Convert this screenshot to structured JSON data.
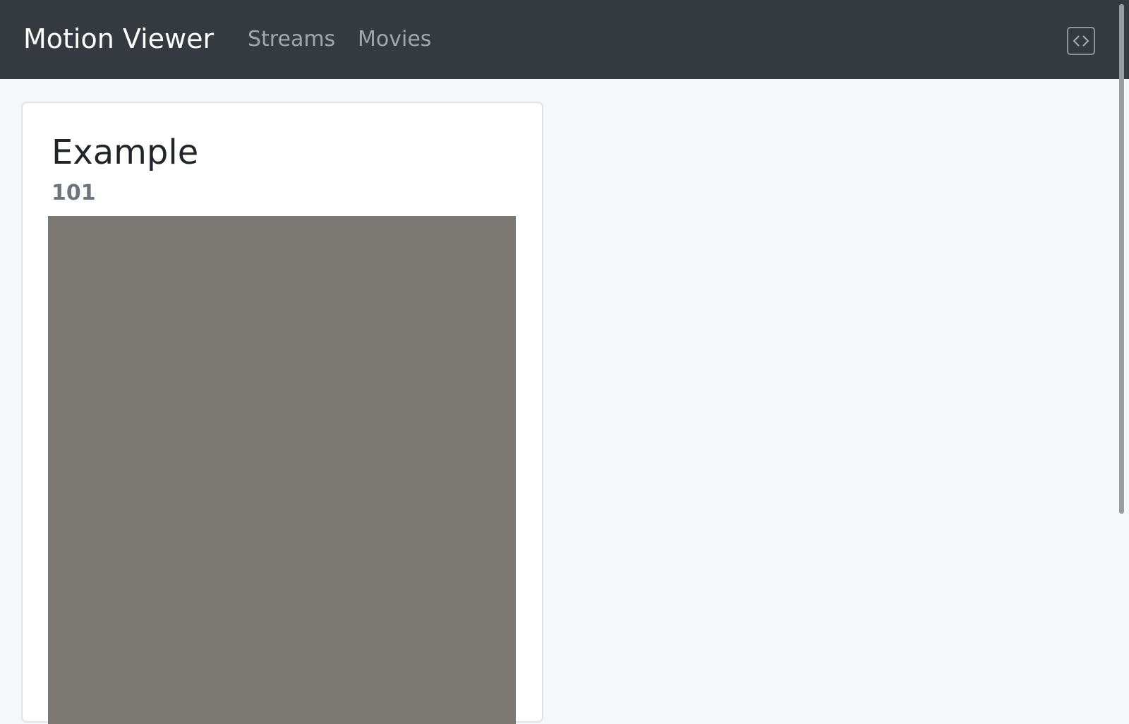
{
  "navbar": {
    "brand": "Motion Viewer",
    "links": [
      {
        "label": "Streams"
      },
      {
        "label": "Movies"
      }
    ],
    "toggler_icon": "code-brackets-icon"
  },
  "card": {
    "title": "Example",
    "subtitle": "101",
    "image_color": "#7b7873"
  },
  "colors": {
    "navbar_bg": "#343a40",
    "page_bg": "#f7f8fa"
  }
}
